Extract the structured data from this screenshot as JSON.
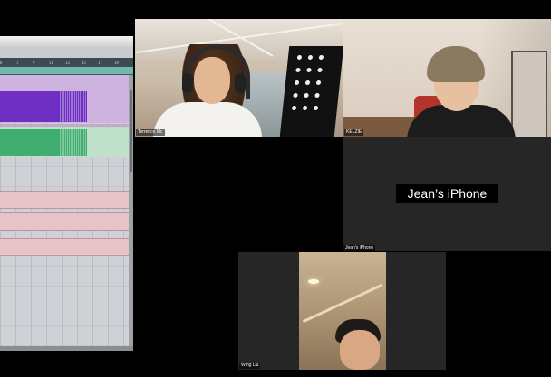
{
  "shared_screen": {
    "app": "daw",
    "ruler_ticks": [
      "8",
      "7",
      "9",
      "11",
      "13",
      "15",
      "17",
      "19"
    ],
    "colors": {
      "ruler": "#3c4a52",
      "marker_lane": "#72b6b0",
      "audio_clip_purple": "#6f2fc2",
      "audio_clip_green": "#3fae6e",
      "track_pink": "#e7c3c8",
      "track_lilac": "#cdb3de"
    }
  },
  "participants": [
    {
      "name": "Terrence Mc",
      "video": "on"
    },
    {
      "name": "KELZIE",
      "video": "on"
    },
    {
      "name": "Jean's iPhone",
      "display_name": "Jean’s iPhone",
      "video": "off"
    },
    {
      "name": "Wing Liu",
      "video": "on"
    }
  ]
}
